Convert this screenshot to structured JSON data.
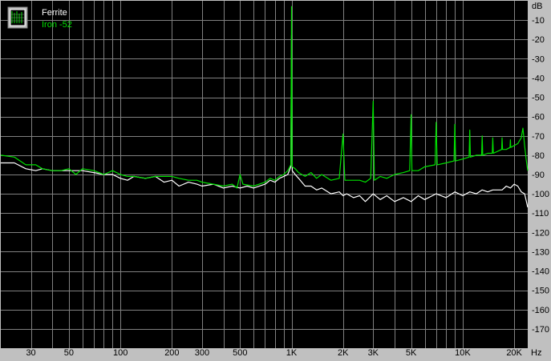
{
  "chart_data": {
    "type": "line",
    "x_scale": "log",
    "xlim": [
      20,
      24000
    ],
    "ylim": [
      -180,
      0
    ],
    "y_unit": "dB",
    "x_unit": "Hz",
    "grid": true,
    "legend_position": "top-left",
    "x_tick_labels": [
      {
        "v": 30,
        "t": "30"
      },
      {
        "v": 50,
        "t": "50"
      },
      {
        "v": 100,
        "t": "100"
      },
      {
        "v": 200,
        "t": "200"
      },
      {
        "v": 300,
        "t": "300"
      },
      {
        "v": 500,
        "t": "500"
      },
      {
        "v": 1000,
        "t": "1K"
      },
      {
        "v": 2000,
        "t": "2K"
      },
      {
        "v": 3000,
        "t": "3K"
      },
      {
        "v": 5000,
        "t": "5K"
      },
      {
        "v": 10000,
        "t": "10K"
      },
      {
        "v": 20000,
        "t": "20K"
      }
    ],
    "y_tick_labels": [
      {
        "v": -10,
        "t": "-10"
      },
      {
        "v": -20,
        "t": "-20"
      },
      {
        "v": -30,
        "t": "-30"
      },
      {
        "v": -40,
        "t": "-40"
      },
      {
        "v": -50,
        "t": "-50"
      },
      {
        "v": -60,
        "t": "-60"
      },
      {
        "v": -70,
        "t": "-70"
      },
      {
        "v": -80,
        "t": "-80"
      },
      {
        "v": -90,
        "t": "-90"
      },
      {
        "v": -100,
        "t": "-100"
      },
      {
        "v": -110,
        "t": "-110"
      },
      {
        "v": -120,
        "t": "-120"
      },
      {
        "v": -130,
        "t": "-130"
      },
      {
        "v": -140,
        "t": "-140"
      },
      {
        "v": -150,
        "t": "-150"
      },
      {
        "v": -160,
        "t": "-160"
      },
      {
        "v": -170,
        "t": "-170"
      }
    ],
    "series": [
      {
        "name": "Ferrite",
        "color": "#ffffff",
        "points": [
          [
            20,
            -84
          ],
          [
            24,
            -84
          ],
          [
            28,
            -87
          ],
          [
            32,
            -88
          ],
          [
            35,
            -87
          ],
          [
            40,
            -88
          ],
          [
            45,
            -88
          ],
          [
            50,
            -88
          ],
          [
            60,
            -88
          ],
          [
            70,
            -89
          ],
          [
            80,
            -90
          ],
          [
            90,
            -90
          ],
          [
            100,
            -92
          ],
          [
            110,
            -93
          ],
          [
            120,
            -91
          ],
          [
            140,
            -92
          ],
          [
            160,
            -91
          ],
          [
            180,
            -94
          ],
          [
            200,
            -93
          ],
          [
            220,
            -96
          ],
          [
            250,
            -94
          ],
          [
            280,
            -95
          ],
          [
            300,
            -96
          ],
          [
            350,
            -95
          ],
          [
            400,
            -97
          ],
          [
            450,
            -96
          ],
          [
            500,
            -97
          ],
          [
            550,
            -96
          ],
          [
            600,
            -97
          ],
          [
            700,
            -95
          ],
          [
            750,
            -93
          ],
          [
            800,
            -94
          ],
          [
            850,
            -92
          ],
          [
            900,
            -91
          ],
          [
            950,
            -90
          ],
          [
            990,
            -86
          ],
          [
            1000,
            -18
          ],
          [
            1010,
            -88
          ],
          [
            1050,
            -90
          ],
          [
            1100,
            -92
          ],
          [
            1200,
            -96
          ],
          [
            1300,
            -96
          ],
          [
            1400,
            -98
          ],
          [
            1500,
            -97
          ],
          [
            1700,
            -100
          ],
          [
            1900,
            -99
          ],
          [
            2000,
            -101
          ],
          [
            2100,
            -100
          ],
          [
            2300,
            -102
          ],
          [
            2500,
            -101
          ],
          [
            2700,
            -104
          ],
          [
            3000,
            -100
          ],
          [
            3300,
            -103
          ],
          [
            3600,
            -101
          ],
          [
            4000,
            -104
          ],
          [
            4500,
            -102
          ],
          [
            5000,
            -104
          ],
          [
            5500,
            -101
          ],
          [
            6000,
            -103
          ],
          [
            7000,
            -100
          ],
          [
            8000,
            -102
          ],
          [
            9000,
            -99
          ],
          [
            10000,
            -101
          ],
          [
            11000,
            -99
          ],
          [
            12000,
            -100
          ],
          [
            13000,
            -98
          ],
          [
            14000,
            -99
          ],
          [
            15000,
            -98
          ],
          [
            16000,
            -98
          ],
          [
            17000,
            -98
          ],
          [
            18000,
            -96
          ],
          [
            19000,
            -97
          ],
          [
            20000,
            -95
          ],
          [
            21000,
            -96
          ],
          [
            22000,
            -99
          ],
          [
            23000,
            -100
          ],
          [
            24000,
            -107
          ]
        ]
      },
      {
        "name": "Iron -52",
        "color": "#00e000",
        "points": [
          [
            20,
            -80
          ],
          [
            24,
            -81
          ],
          [
            28,
            -85
          ],
          [
            32,
            -85
          ],
          [
            35,
            -87
          ],
          [
            40,
            -88
          ],
          [
            45,
            -88
          ],
          [
            50,
            -87
          ],
          [
            55,
            -90
          ],
          [
            60,
            -87
          ],
          [
            70,
            -88
          ],
          [
            80,
            -90
          ],
          [
            90,
            -88
          ],
          [
            100,
            -90
          ],
          [
            110,
            -91
          ],
          [
            120,
            -91
          ],
          [
            140,
            -92
          ],
          [
            160,
            -91
          ],
          [
            180,
            -91
          ],
          [
            200,
            -91
          ],
          [
            220,
            -92
          ],
          [
            250,
            -93
          ],
          [
            280,
            -93
          ],
          [
            300,
            -94
          ],
          [
            350,
            -95
          ],
          [
            400,
            -96
          ],
          [
            450,
            -95
          ],
          [
            480,
            -97
          ],
          [
            500,
            -90
          ],
          [
            520,
            -95
          ],
          [
            600,
            -96
          ],
          [
            700,
            -94
          ],
          [
            750,
            -92
          ],
          [
            800,
            -93
          ],
          [
            850,
            -91
          ],
          [
            900,
            -90
          ],
          [
            950,
            -88
          ],
          [
            990,
            -85
          ],
          [
            1000,
            -3
          ],
          [
            1010,
            -86
          ],
          [
            1050,
            -87
          ],
          [
            1100,
            -89
          ],
          [
            1200,
            -91
          ],
          [
            1300,
            -89
          ],
          [
            1400,
            -92
          ],
          [
            1500,
            -90
          ],
          [
            1700,
            -93
          ],
          [
            1900,
            -92
          ],
          [
            2000,
            -69
          ],
          [
            2050,
            -93
          ],
          [
            2300,
            -93
          ],
          [
            2500,
            -93
          ],
          [
            2700,
            -94
          ],
          [
            2900,
            -92
          ],
          [
            3000,
            -52
          ],
          [
            3050,
            -93
          ],
          [
            3300,
            -91
          ],
          [
            3600,
            -92
          ],
          [
            4000,
            -90
          ],
          [
            4500,
            -89
          ],
          [
            4900,
            -88
          ],
          [
            5000,
            -59
          ],
          [
            5050,
            -88
          ],
          [
            5500,
            -88
          ],
          [
            6000,
            -86
          ],
          [
            6900,
            -85
          ],
          [
            7000,
            -63
          ],
          [
            7100,
            -85
          ],
          [
            8000,
            -84
          ],
          [
            8900,
            -83
          ],
          [
            9000,
            -64
          ],
          [
            9100,
            -83
          ],
          [
            10000,
            -82
          ],
          [
            10900,
            -81
          ],
          [
            11000,
            -67
          ],
          [
            11100,
            -81
          ],
          [
            12000,
            -80
          ],
          [
            12900,
            -80
          ],
          [
            13000,
            -70
          ],
          [
            13100,
            -80
          ],
          [
            14000,
            -79
          ],
          [
            14900,
            -79
          ],
          [
            15000,
            -71
          ],
          [
            15100,
            -79
          ],
          [
            16000,
            -78
          ],
          [
            16900,
            -77
          ],
          [
            17000,
            -71
          ],
          [
            17100,
            -77
          ],
          [
            18000,
            -77
          ],
          [
            18900,
            -76
          ],
          [
            19000,
            -72
          ],
          [
            19100,
            -76
          ],
          [
            20000,
            -75
          ],
          [
            21000,
            -74
          ],
          [
            22000,
            -71
          ],
          [
            22500,
            -66
          ],
          [
            23000,
            -75
          ],
          [
            23500,
            -82
          ],
          [
            24000,
            -88
          ]
        ]
      }
    ]
  }
}
